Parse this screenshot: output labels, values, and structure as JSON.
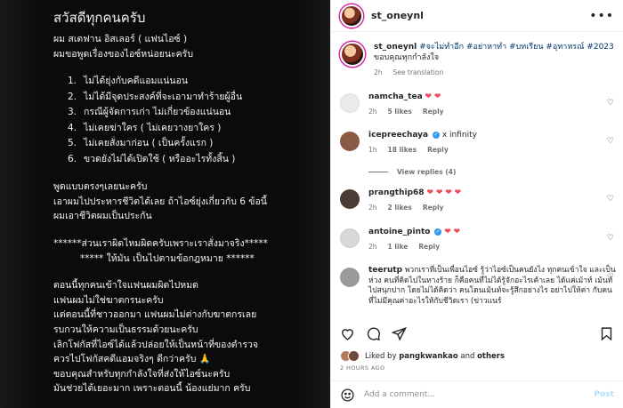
{
  "image": {
    "greeting": "สวัสดีทุกคนครับ",
    "intro": [
      "ผม สเตฟาน อิสเลอร์ ( แฟนไอซ์ )",
      "ผมขอพูดเรื่องของไอซ์หน่อยนะครับ"
    ],
    "list": [
      {
        "num": "1.",
        "text": "ไม่ได้ยุ่งกับคดีแอมแน่นอน"
      },
      {
        "num": "2.",
        "text": "ไม่ได้มีจุดประสงค์ที่จะเอามาทำร้ายผู้อื่น"
      },
      {
        "num": "3.",
        "text": "กรณีผู้จัดการเก่า ไม่เกี่ยวข้องแน่นอน"
      },
      {
        "num": "4.",
        "text": "ไม่เคยฆ่าใคร ( ไม่เคยวางยาใคร )"
      },
      {
        "num": "5.",
        "text": "ไม่เคยสั่งมาก่อน ( เป็นครั้งแรก )"
      },
      {
        "num": "6.",
        "text": "ขวดยังไม่ได้เปิดใช้ ( หรืออะไรทั้งสิ้น )"
      }
    ],
    "para2": [
      "พูดแบบตรงๆเลยนะครับ",
      "เอาผมไปประหารชีวิตได้เลย ถ้าไอซ์ยุ่งเกี่ยวกับ 6 ข้อนี้",
      "ผมเอาชีวิตผมเป็นประกัน"
    ],
    "quote": [
      "******ส่วนเราผิดไหมผิดครับเพราะเราสั่งมาจริง*****",
      "***** ให้มัน เป็นไปตามข้อกฎหมาย ******"
    ],
    "para3": [
      "ตอนนี้ทุกคนเข้าใจแฟนผมผิดไปหมด",
      "แฟนผมไม่ใช่ฆาตกรนะครับ",
      "แต่ตอนนี้ที่ชาวออกมา แฟนผมไม่ต่างกับฆาตกรเลย",
      "รบกวนให้ความเป็นธรรมด้วยนะครับ",
      "เลิกโฟกัสที่ไอซ์ได้แล้วปล่อยให้เป็นหน้าที่ของตำรวจ",
      "ควรไปโฟกัสคดีแอมจริงๆ ดีกว่าครับ 🙏",
      "ขอบคุณสำหรับทุกกำลังใจที่ส่งให้ไอซ์นะครับ",
      "มันช่วยได้เยอะมาก เพราะตอนนี้ น้องแย่มาก ครับ"
    ]
  },
  "header": {
    "username": "st_oneynl",
    "more": "•••"
  },
  "caption": {
    "username": "st_oneynl",
    "hashtags": "#จะไม่ทำอีก #อย่าหาทำ #บทเรียน #อุทาหรณ์ #2023",
    "text": "ขอบคุณทุกกำลังใจ",
    "time": "2h",
    "see_translation": "See translation"
  },
  "comments": [
    {
      "username": "namcha_tea",
      "text": "❤️❤️",
      "time": "2h",
      "likes": "5 likes",
      "reply": "Reply",
      "avatar_color": "#e8e8e8",
      "hearts": "❤ ❤"
    },
    {
      "username": "icepreechaya",
      "text": "x infinity",
      "time": "1h",
      "likes": "18 likes",
      "reply": "Reply",
      "avatar_color": "#8a5a44",
      "verified": "✓"
    },
    {
      "username": "prangthip68",
      "text": "❤️❤️❤️❤️",
      "time": "2h",
      "likes": "2 likes",
      "reply": "Reply",
      "avatar_color": "#4a3b35",
      "hearts": "❤ ❤ ❤ ❤"
    },
    {
      "username": "antoine_pinto",
      "text": "❤️❤️",
      "time": "2h",
      "likes": "1 like",
      "reply": "Reply",
      "avatar_color": "#c9c9c9",
      "verified": "✓",
      "hearts": "❤ ❤"
    },
    {
      "username": "teerutp",
      "text": "พวกเราที่เป็นเพื่อนไอซ์ รู้ว่าไอซ์เป็นคนยังไง ทุกคนเข้าใจ และเป็นห่วง คนที่คิดไปในทางร้าย ก็คือคนที่ไม่ได้รู้จักอะไรเค้าเลย ได้แค่เม้าท์ เม้นท์ ไปสนุกปาก โดยไม่ได้คิดว่า คนโดนเม้นท์จะรู้สึกอย่างไร อย่าไปให้ค่า กับคนที่ไม่มีคุณค่าอะไรให้กับชีวิตเรา (ข่าวแนร์",
      "avatar_color": "#9a9a9a"
    }
  ],
  "view_replies": "View replies (4)",
  "likes": {
    "prefix": "Liked by",
    "user": "pangkwankao",
    "and": "and",
    "others": "others"
  },
  "time_ago": "2 HOURS AGO",
  "add_comment": {
    "placeholder": "Add a comment...",
    "post": "Post"
  }
}
